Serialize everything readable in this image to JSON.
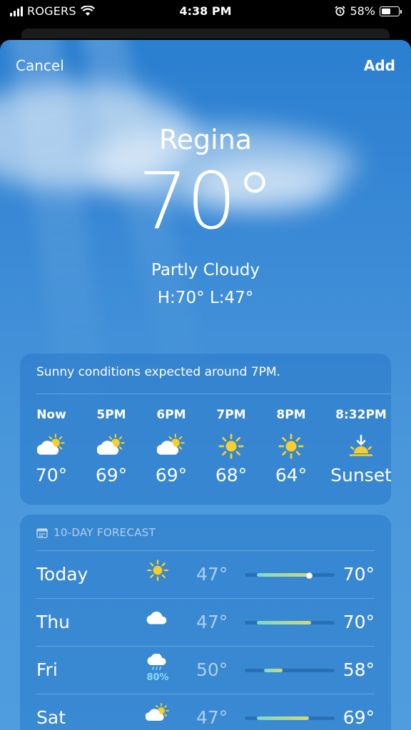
{
  "status": {
    "carrier": "ROGERS",
    "time": "4:38 PM",
    "battery": "58%",
    "battery_level": 0.58
  },
  "nav": {
    "cancel": "Cancel",
    "add": "Add"
  },
  "current": {
    "city": "Regina",
    "temp": "70°",
    "condition": "Partly Cloudy",
    "hilo": "H:70°  L:47°"
  },
  "hourly": {
    "summary": "Sunny conditions expected around 7PM.",
    "items": [
      {
        "label": "Now",
        "icon": "partly-cloudy-icon",
        "temp": "70°"
      },
      {
        "label": "5PM",
        "icon": "partly-cloudy-icon",
        "temp": "69°"
      },
      {
        "label": "6PM",
        "icon": "partly-cloudy-icon",
        "temp": "69°"
      },
      {
        "label": "7PM",
        "icon": "sun-icon",
        "temp": "68°"
      },
      {
        "label": "8PM",
        "icon": "sun-icon",
        "temp": "64°"
      },
      {
        "label": "8:32PM",
        "icon": "sunset-icon",
        "temp": "Sunset"
      }
    ]
  },
  "daily": {
    "header": "10-DAY FORECAST",
    "rows": [
      {
        "day": "Today",
        "icon": "sun-icon",
        "precip": "",
        "lo": "47°",
        "hi": "70°",
        "range": [
          47,
          70
        ],
        "current": 69
      },
      {
        "day": "Thu",
        "icon": "cloud-icon",
        "precip": "",
        "lo": "47°",
        "hi": "70°",
        "range": [
          47,
          70
        ]
      },
      {
        "day": "Fri",
        "icon": "rain-cloud-icon",
        "precip": "80%",
        "lo": "50°",
        "hi": "58°",
        "range": [
          50,
          58
        ]
      },
      {
        "day": "Sat",
        "icon": "partly-cloudy-icon",
        "precip": "",
        "lo": "47°",
        "hi": "69°",
        "range": [
          47,
          69
        ]
      }
    ],
    "scale": [
      42,
      80
    ]
  }
}
